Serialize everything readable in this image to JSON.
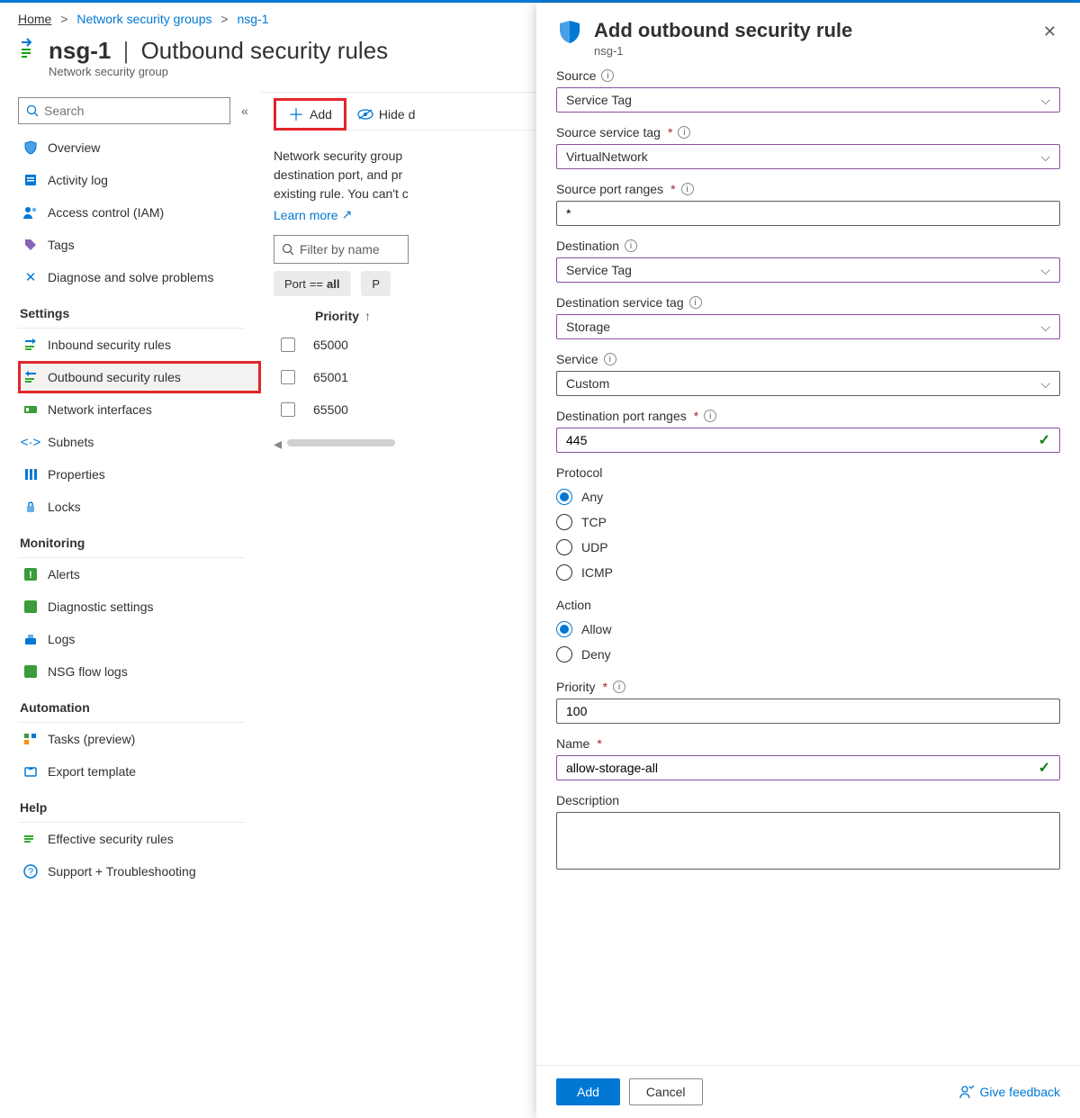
{
  "breadcrumb": {
    "home": "Home",
    "group": "Network security groups",
    "item": "nsg-1"
  },
  "header": {
    "title": "nsg-1",
    "section": "Outbound security rules",
    "subtitle": "Network security group"
  },
  "sidebar": {
    "search_placeholder": "Search",
    "items": [
      {
        "label": "Overview"
      },
      {
        "label": "Activity log"
      },
      {
        "label": "Access control (IAM)"
      },
      {
        "label": "Tags"
      },
      {
        "label": "Diagnose and solve problems"
      }
    ],
    "groups": {
      "settings": {
        "label": "Settings",
        "items": [
          {
            "label": "Inbound security rules"
          },
          {
            "label": "Outbound security rules",
            "selected": true
          },
          {
            "label": "Network interfaces"
          },
          {
            "label": "Subnets"
          },
          {
            "label": "Properties"
          },
          {
            "label": "Locks"
          }
        ]
      },
      "monitoring": {
        "label": "Monitoring",
        "items": [
          {
            "label": "Alerts"
          },
          {
            "label": "Diagnostic settings"
          },
          {
            "label": "Logs"
          },
          {
            "label": "NSG flow logs"
          }
        ]
      },
      "automation": {
        "label": "Automation",
        "items": [
          {
            "label": "Tasks (preview)"
          },
          {
            "label": "Export template"
          }
        ]
      },
      "help": {
        "label": "Help",
        "items": [
          {
            "label": "Effective security rules"
          },
          {
            "label": "Support + Troubleshooting"
          }
        ]
      }
    }
  },
  "toolbar": {
    "add": "Add",
    "hide": "Hide d"
  },
  "main": {
    "desc": "Network security group destination port, and pr existing rule. You can't c",
    "learn": "Learn more",
    "filter_placeholder": "Filter by name",
    "pill_port_label": "Port",
    "pill_port_op": "==",
    "pill_port_val": "all",
    "pill_p": "P",
    "col_priority": "Priority",
    "rows": [
      {
        "priority": "65000"
      },
      {
        "priority": "65001"
      },
      {
        "priority": "65500"
      }
    ]
  },
  "panel": {
    "title": "Add outbound security rule",
    "subtitle": "nsg-1",
    "labels": {
      "source": "Source",
      "source_tag": "Source service tag",
      "source_ports": "Source port ranges",
      "dest": "Destination",
      "dest_tag": "Destination service tag",
      "service": "Service",
      "dest_ports": "Destination port ranges",
      "protocol": "Protocol",
      "action": "Action",
      "priority": "Priority",
      "name": "Name",
      "description": "Description"
    },
    "values": {
      "source": "Service Tag",
      "source_tag": "VirtualNetwork",
      "source_ports": "*",
      "dest": "Service Tag",
      "dest_tag": "Storage",
      "service": "Custom",
      "dest_ports": "445",
      "priority": "100",
      "name": "allow-storage-all"
    },
    "protocol_options": [
      "Any",
      "TCP",
      "UDP",
      "ICMP"
    ],
    "protocol_selected": "Any",
    "action_options": [
      "Allow",
      "Deny"
    ],
    "action_selected": "Allow",
    "footer": {
      "add": "Add",
      "cancel": "Cancel",
      "feedback": "Give feedback"
    }
  }
}
